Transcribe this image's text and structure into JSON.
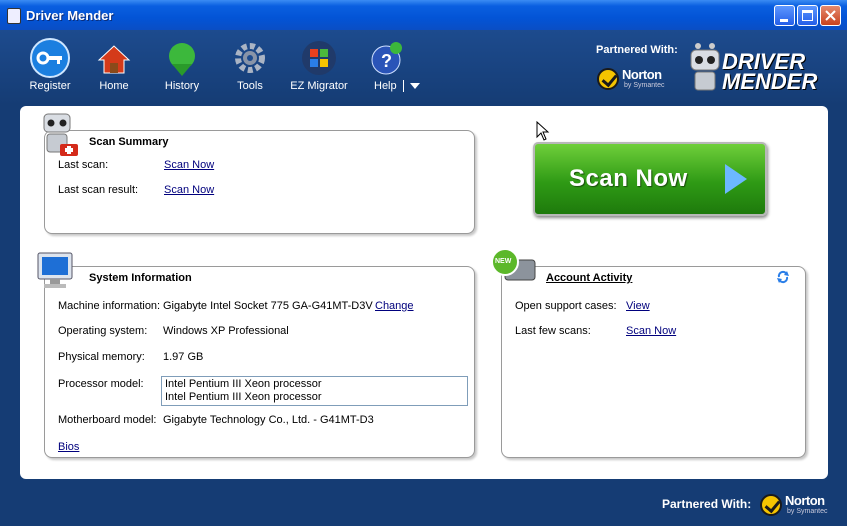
{
  "window": {
    "title": "Driver Mender"
  },
  "toolbar": {
    "register": "Register",
    "home": "Home",
    "history": "History",
    "tools": "Tools",
    "ez_migrator": "EZ Migrator",
    "help": "Help"
  },
  "partner": {
    "label": "Partnered With:",
    "norton": "Norton",
    "norton_sub": "by Symantec"
  },
  "brand": {
    "line1": "DRIVER",
    "line2": "MENDER"
  },
  "scan_summary": {
    "title": "Scan Summary",
    "last_scan_label": "Last scan:",
    "last_scan_link": "Scan Now",
    "last_result_label": "Last scan result:",
    "last_result_link": "Scan Now"
  },
  "scan_button": {
    "label": "Scan Now"
  },
  "system_info": {
    "title": "System Information",
    "machine_label": "Machine information:",
    "machine_value": "Gigabyte Intel Socket 775 GA-G41MT-D3V",
    "change_link": "Change",
    "os_label": "Operating system:",
    "os_value": "Windows XP Professional",
    "memory_label": "Physical memory:",
    "memory_value": "1.97 GB",
    "processor_label": "Processor model:",
    "processors": [
      "Intel Pentium III Xeon processor",
      "Intel Pentium III Xeon processor"
    ],
    "motherboard_label": "Motherboard model:",
    "motherboard_value": "Gigabyte Technology Co., Ltd. - G41MT-D3",
    "bios_link": "Bios"
  },
  "account_activity": {
    "title": "Account Activity",
    "badge": "NEW",
    "support_label": "Open support cases:",
    "support_link": "View",
    "scans_label": "Last few scans:",
    "scans_link": "Scan Now"
  },
  "colors": {
    "accent_green": "#2f9a15",
    "title_blue": "#0354d6",
    "link": "#00007d",
    "background": "#153c74"
  }
}
